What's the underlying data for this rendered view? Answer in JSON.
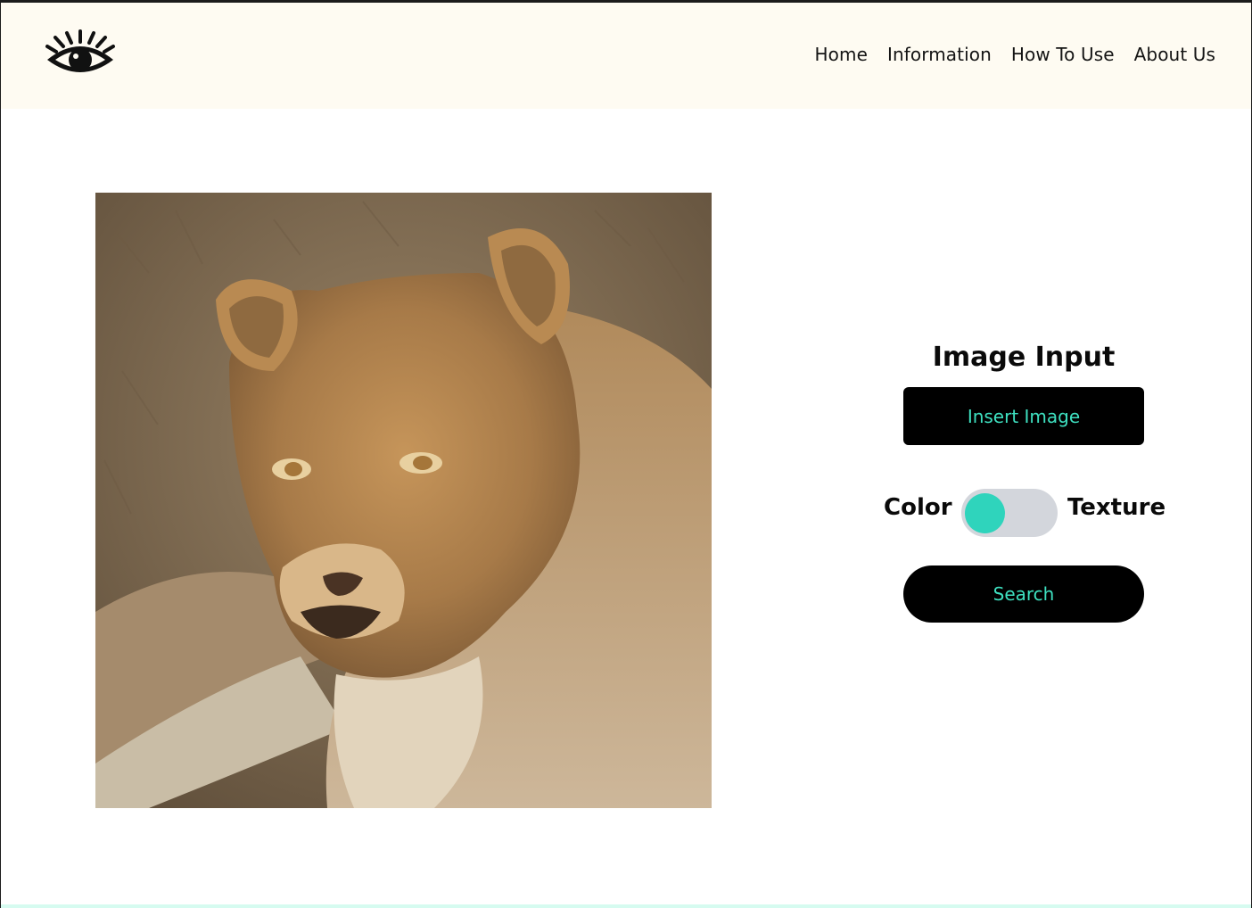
{
  "nav": {
    "items": [
      "Home",
      "Information",
      "How To Use",
      "About Us"
    ]
  },
  "icons": {
    "logo": "eye-logo-icon"
  },
  "panel": {
    "title": "Image Input",
    "insert_label": "Insert Image",
    "toggle_left": "Color",
    "toggle_right": "Texture",
    "toggle_state": "Color",
    "search_label": "Search"
  },
  "colors": {
    "header_bg": "#fefbf2",
    "accent": "#3ee0c0",
    "toggle_knob": "#2fd4bc",
    "toggle_track": "#d3d6dc",
    "button_bg": "#000000"
  }
}
